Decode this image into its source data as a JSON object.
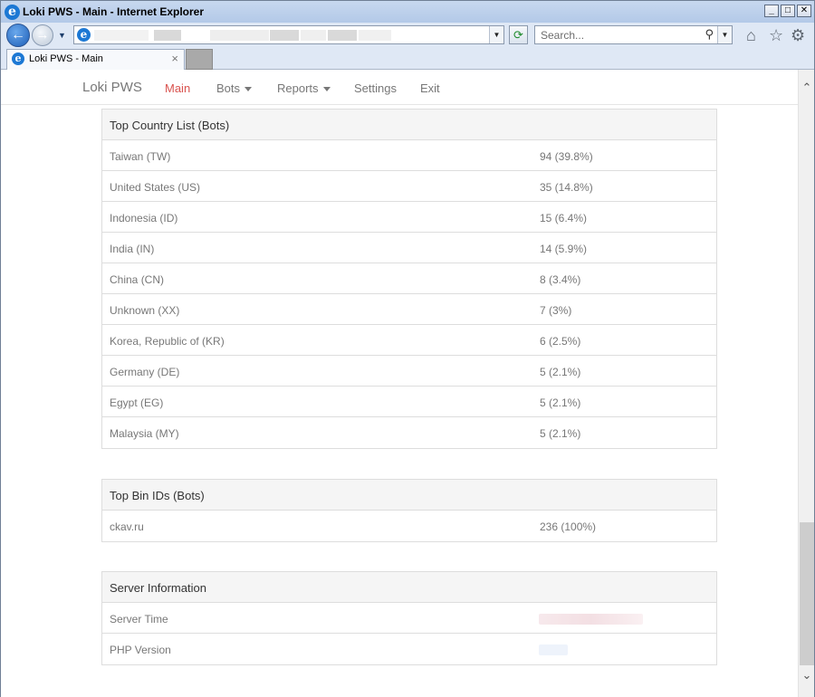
{
  "window": {
    "title": "Loki PWS - Main - Internet Explorer",
    "controls": [
      "_",
      "□",
      "✕"
    ]
  },
  "toolbar": {
    "search_placeholder": "Search...",
    "icons": [
      "back-icon",
      "forward-icon",
      "refresh-icon",
      "search-icon",
      "home-icon",
      "favorites-star-icon",
      "tools-gear-icon"
    ]
  },
  "tab": {
    "label": "Loki PWS - Main",
    "close": "×"
  },
  "nav": {
    "brand": "Loki PWS",
    "items": [
      {
        "label": "Main",
        "active": true
      },
      {
        "label": "Bots",
        "dropdown": true
      },
      {
        "label": "Reports",
        "dropdown": true
      },
      {
        "label": "Settings"
      },
      {
        "label": "Exit"
      }
    ]
  },
  "country_panel": {
    "title": "Top Country List (Bots)",
    "rows": [
      {
        "country": "Taiwan (TW)",
        "count": "94 (39.8%)"
      },
      {
        "country": "United States (US)",
        "count": "35 (14.8%)"
      },
      {
        "country": "Indonesia (ID)",
        "count": "15 (6.4%)"
      },
      {
        "country": "India (IN)",
        "count": "14 (5.9%)"
      },
      {
        "country": "China (CN)",
        "count": "8 (3.4%)"
      },
      {
        "country": "Unknown (XX)",
        "count": "7 (3%)"
      },
      {
        "country": "Korea, Republic of (KR)",
        "count": "6 (2.5%)"
      },
      {
        "country": "Germany (DE)",
        "count": "5 (2.1%)"
      },
      {
        "country": "Egypt (EG)",
        "count": "5 (2.1%)"
      },
      {
        "country": "Malaysia (MY)",
        "count": "5 (2.1%)"
      }
    ]
  },
  "bin_panel": {
    "title": "Top Bin IDs (Bots)",
    "rows": [
      {
        "id": "ckav.ru",
        "count": "236 (100%)"
      }
    ]
  },
  "server_panel": {
    "title": "Server Information",
    "rows": [
      {
        "label": "Server Time",
        "value": ""
      },
      {
        "label": "PHP Version",
        "value": ""
      }
    ]
  }
}
